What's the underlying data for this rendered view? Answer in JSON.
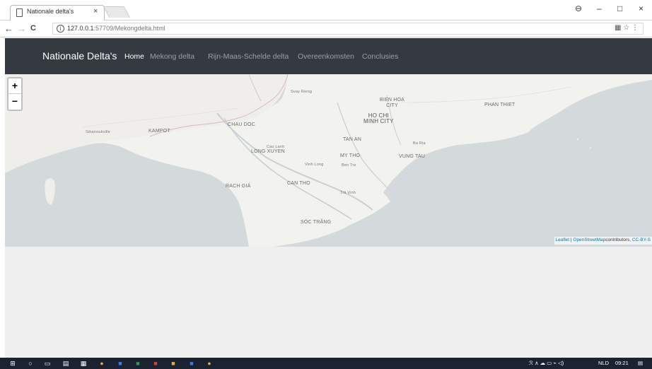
{
  "browser": {
    "tab_title": "Nationale delta's",
    "tab_close": "×",
    "url_host": "127.0.0.1",
    "url_rest": ":57709/Mekongdelta.html",
    "controls": {
      "profile": "⊖",
      "minimize": "–",
      "maximize": "□",
      "close": "×"
    },
    "nav": {
      "back": "←",
      "forward": "→",
      "reload": "C"
    },
    "omni_icons": "▦ ☆ ⋮"
  },
  "navbar": {
    "brand": "Nationale Delta's",
    "links": [
      {
        "label": "Home",
        "active": true
      },
      {
        "label": "Mekong delta",
        "active": false
      },
      {
        "label": "Rijn-Maas-Schelde delta",
        "active": false
      },
      {
        "label": "Overeenkomsten",
        "active": false
      },
      {
        "label": "Conclusies",
        "active": false
      }
    ]
  },
  "map": {
    "zoom_in": "+",
    "zoom_out": "−",
    "places": {
      "svay_rieng": "Svay Rieng",
      "bien_hoa": "BIEN HOA\nCITY",
      "phan_thiet": "PHAN THIET",
      "ho_chi_minh": "HO CHI\nMINH CITY",
      "chau_doc": "CHAU DOC",
      "sihanoukville": "Sihanoukville",
      "kampot": "KAMPOT",
      "tan_an": "TAN AN",
      "ba_ria": "Ba Ria",
      "cao_lanh": "Cao Lanh",
      "long_xuyen": "LONG XUYEN",
      "my_tho": "MY THO",
      "vung_tau": "VUNG TAU",
      "vinh_long": "Vinh Long",
      "ben_tre": "Ben Tre",
      "rach_gia": "RACH GIÁ",
      "can_tho": "CAN THO",
      "tra_vinh": "Trà Vinh",
      "soc_trang": "SÓC TRĂNG"
    },
    "attribution": {
      "leaflet": "Leaflet",
      "sep": " | ",
      "osm": "OpenStreetMap",
      "contrib": "contributors, ",
      "license": "CC-BY-S"
    }
  },
  "taskbar": {
    "lang": "NLD",
    "time": "09:21"
  },
  "colors": {
    "navbar": "#343a40",
    "water": "#d4dadc",
    "land": "#f2f2ef"
  }
}
